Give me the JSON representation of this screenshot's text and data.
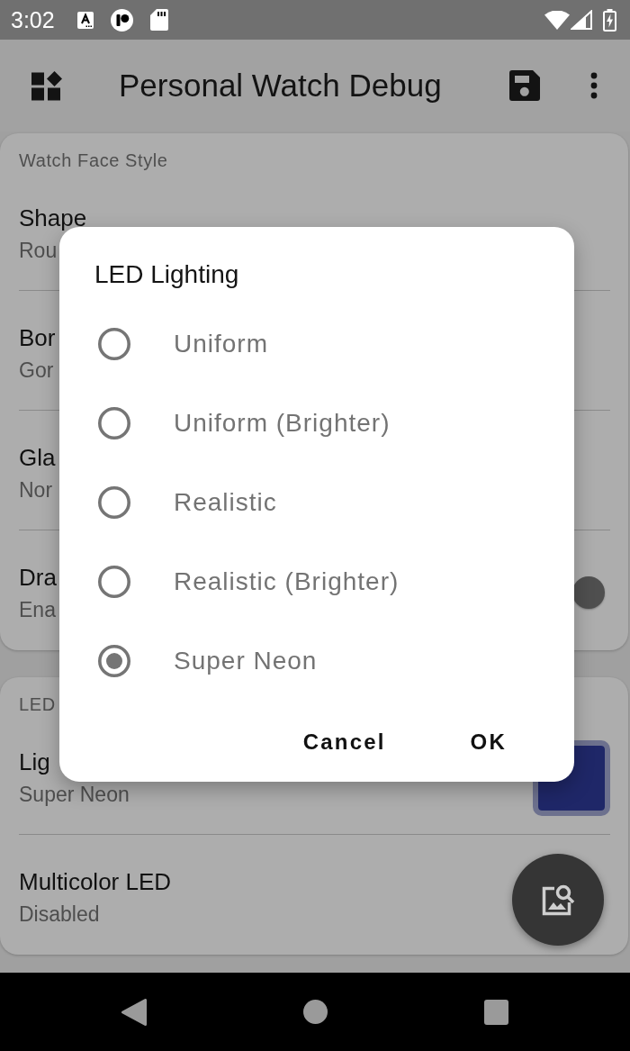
{
  "status_bar": {
    "time": "3:02"
  },
  "app_bar": {
    "title": "Personal Watch Debug"
  },
  "sections": [
    {
      "header": "Watch Face Style",
      "items": [
        {
          "kind": "text",
          "title": "Shape",
          "summary": "Rou"
        },
        {
          "kind": "text",
          "title": "Bor",
          "summary": "Gor"
        },
        {
          "kind": "text",
          "title": "Gla",
          "summary": "Nor"
        },
        {
          "kind": "switch",
          "title": "Dra",
          "summary": "Ena",
          "on": true
        }
      ]
    },
    {
      "header": "LED",
      "items": [
        {
          "kind": "color",
          "title": "Lig",
          "summary": "Super Neon",
          "color": "#1f2768"
        },
        {
          "kind": "text",
          "title": "Multicolor LED",
          "summary": "Disabled"
        }
      ]
    }
  ],
  "dialog": {
    "title": "LED Lighting",
    "options": [
      {
        "label": "Uniform",
        "selected": false
      },
      {
        "label": "Uniform (Brighter)",
        "selected": false
      },
      {
        "label": "Realistic",
        "selected": false
      },
      {
        "label": "Realistic (Brighter)",
        "selected": false
      },
      {
        "label": "Super Neon",
        "selected": true
      }
    ],
    "buttons": [
      "Cancel",
      "OK"
    ]
  }
}
